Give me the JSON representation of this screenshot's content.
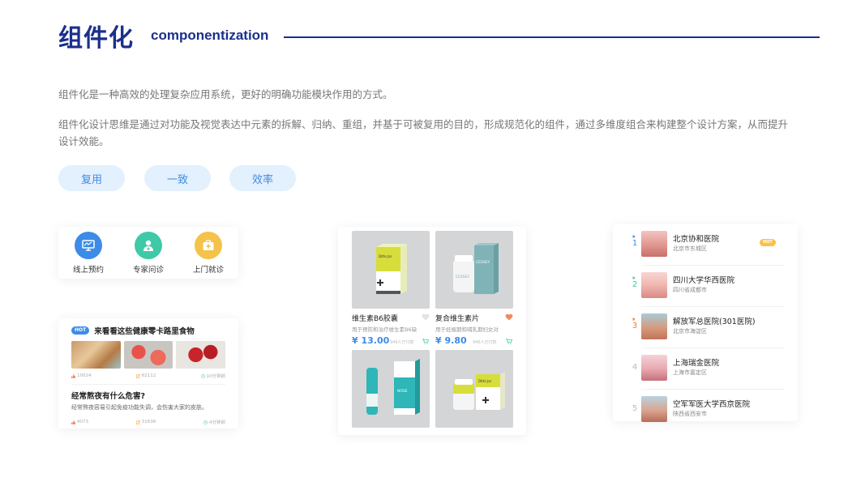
{
  "header": {
    "title_cn": "组件化",
    "title_en": "componentization"
  },
  "intro": {
    "p1": "组件化是一种高效的处理复杂应用系统，更好的明确功能模块作用的方式。",
    "p2": "组件化设计思维是通过对功能及视觉表达中元素的拆解、归纳、重组，并基于可被复用的目的，形成规范化的组件，通过多维度组合来构建整个设计方案，从而提升设计效能。"
  },
  "tags": [
    "复用",
    "一致",
    "效率"
  ],
  "services": [
    {
      "label": "线上预约",
      "icon": "monitor-icon",
      "color": "#3d8be8"
    },
    {
      "label": "专家问诊",
      "icon": "doctor-icon",
      "color": "#3ec9a7"
    },
    {
      "label": "上门就诊",
      "icon": "medical-kit-icon",
      "color": "#f5c24a"
    }
  ],
  "articles": {
    "hot": "HOT",
    "a1": {
      "title": "来看看这些健康零卡路里食物",
      "likes": "10024",
      "shares": "62112",
      "time": "10分钟前"
    },
    "a2": {
      "title": "经常熬夜有什么危害?",
      "desc": "经常熬夜容易引起免疫功能失调，会伤害大家的皮肤。",
      "likes": "4073",
      "shares": "31638",
      "time": "4分钟前"
    }
  },
  "products": [
    {
      "name": "维生素B6胶囊",
      "sub": "用于预防和治疗维生素B6缺",
      "price": "¥ 13.00",
      "sold": "946人已付款",
      "liked": false,
      "box_color": "#d7de3b",
      "box_text": "Ditto Jar"
    },
    {
      "name": "复合维生素片",
      "sub": "用于妊娠期和哺乳期妇女对",
      "price": "¥ 9.80",
      "sold": "946人已付款",
      "liked": true,
      "box_color": "#7fb3b7",
      "box_text": "CESSEY"
    },
    {
      "name": "",
      "sub": "",
      "price": "",
      "sold": "",
      "liked": false,
      "box_color": "#2eb6b8",
      "box_text": "NOSE"
    },
    {
      "name": "",
      "sub": "",
      "price": "",
      "sold": "",
      "liked": false,
      "box_color": "#d7de3b",
      "box_text": "Ditto Jar"
    }
  ],
  "hospitals": [
    {
      "rank": "1",
      "name": "北京协和医院",
      "addr": "北京市东城区",
      "hot": "HOT",
      "rank_color": "#3d8be8"
    },
    {
      "rank": "2",
      "name": "四川大学华西医院",
      "addr": "四川省成都市",
      "hot": "",
      "rank_color": "#3ec9a7"
    },
    {
      "rank": "3",
      "name": "解放军总医院(301医院)",
      "addr": "北京市海淀区",
      "hot": "",
      "rank_color": "#ef7d3c"
    },
    {
      "rank": "4",
      "name": "上海瑞金医院",
      "addr": "上海市嘉定区",
      "hot": "",
      "rank_color": "#bbbbbb"
    },
    {
      "rank": "5",
      "name": "空军军医大学西京医院",
      "addr": "陕西省西安市",
      "hot": "",
      "rank_color": "#bbbbbb"
    }
  ]
}
